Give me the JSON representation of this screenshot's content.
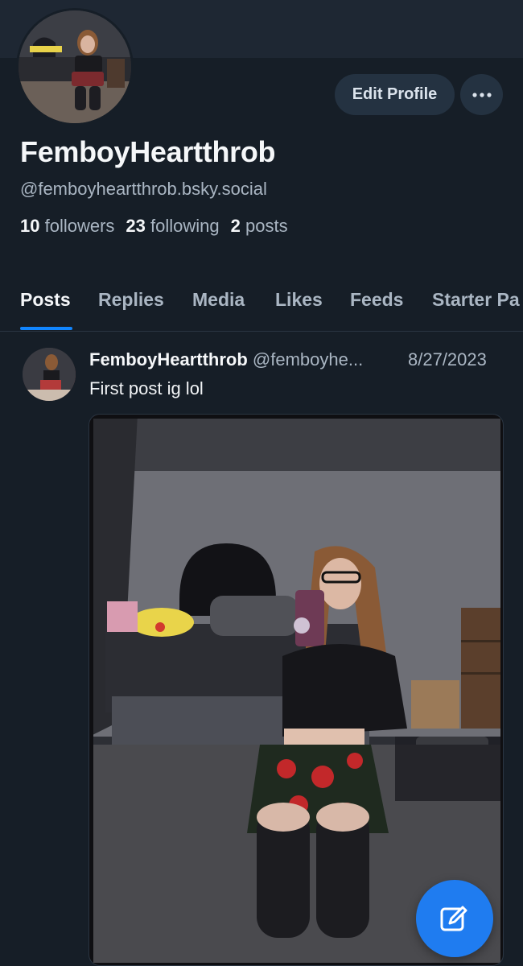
{
  "profile": {
    "display_name": "FemboyHeartthrob",
    "handle": "@femboyheartthrob.bsky.social",
    "stats": {
      "followers_count": "10",
      "followers_label": "followers",
      "following_count": "23",
      "following_label": "following",
      "posts_count": "2",
      "posts_label": "posts"
    },
    "edit_button_label": "Edit Profile",
    "more_icon": "ellipsis-icon"
  },
  "tabs": [
    {
      "label": "Posts",
      "active": true
    },
    {
      "label": "Replies"
    },
    {
      "label": "Media"
    },
    {
      "label": "Likes"
    },
    {
      "label": "Feeds"
    },
    {
      "label": "Starter Pa"
    }
  ],
  "post": {
    "author_name": "FemboyHeartthrob",
    "author_handle": "@femboyhe...",
    "date": "8/27/2023",
    "text": "First post ig lol"
  },
  "fab": {
    "icon": "compose-icon"
  },
  "colors": {
    "accent": "#1185fe",
    "background": "#161e27",
    "fab": "#1f7cf0"
  }
}
